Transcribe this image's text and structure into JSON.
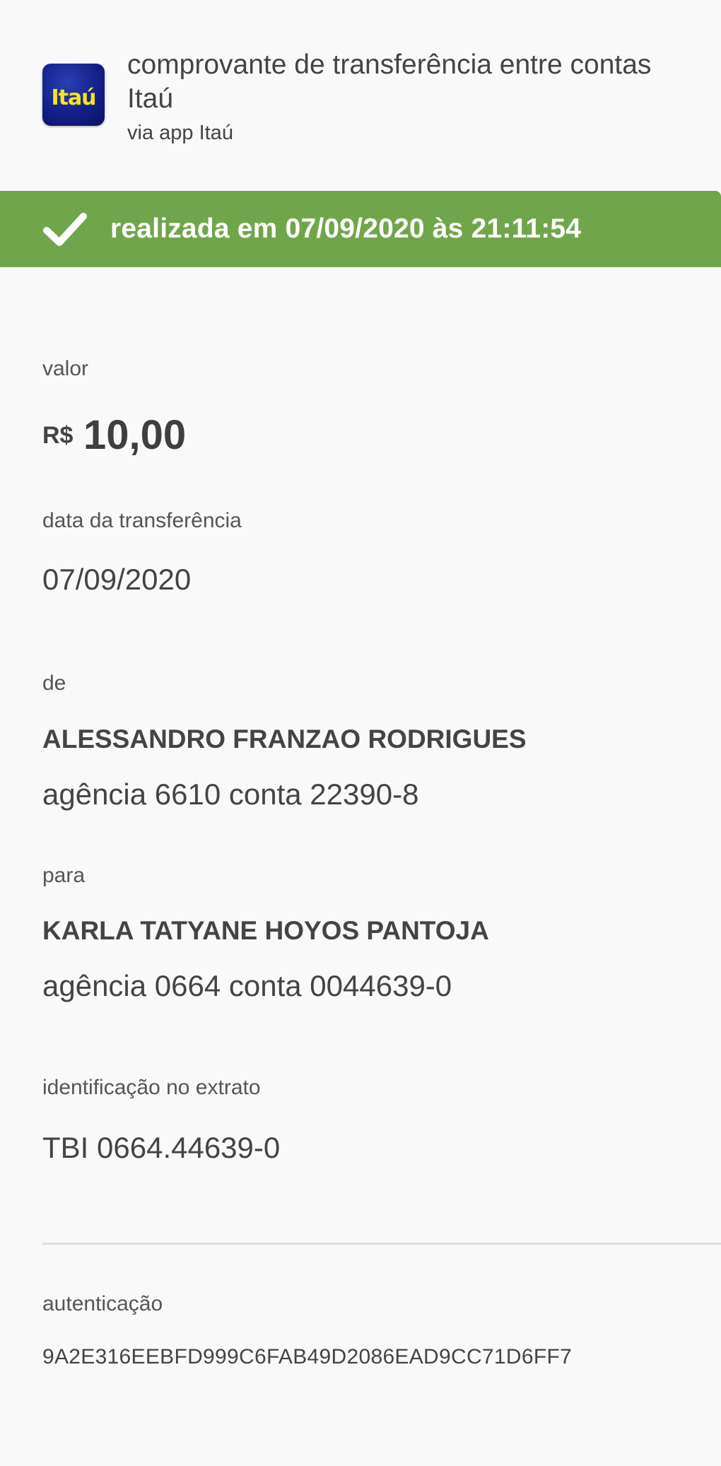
{
  "header": {
    "logo_text": "Itaú",
    "title": "comprovante de transferência entre contas Itaú",
    "subtitle": "via app Itaú"
  },
  "status": {
    "text": "realizada em 07/09/2020 às 21:11:54",
    "icon": "checkmark-icon",
    "color": "#70a64b"
  },
  "valor": {
    "label": "valor",
    "currency": "R$",
    "amount": "10,00"
  },
  "data_transferencia": {
    "label": "data da transferência",
    "value": "07/09/2020"
  },
  "de": {
    "label": "de",
    "name": "ALESSANDRO FRANZAO RODRIGUES",
    "account": "agência 6610 conta 22390-8"
  },
  "para": {
    "label": "para",
    "name": "KARLA TATYANE HOYOS PANTOJA",
    "account": "agência 0664 conta 0044639-0"
  },
  "extrato": {
    "label": "identificação no extrato",
    "value": "TBI 0664.44639-0"
  },
  "autenticacao": {
    "label": "autenticação",
    "code": "9A2E316EEBFD999C6FAB49D2086EAD9CC71D6FF7"
  }
}
